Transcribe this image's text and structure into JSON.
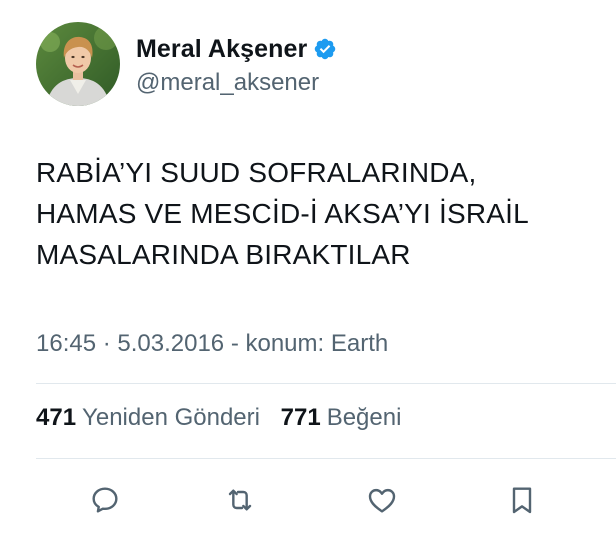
{
  "tweet": {
    "author": {
      "display_name": "Meral Akşener",
      "handle": "@meral_aksener",
      "verified_icon": "verified-badge-icon",
      "verified_color": "#1d9bf0"
    },
    "text_lines": [
      "RABİA’YI SUUD SOFRALARINDA,",
      "HAMAS VE MESCİD-İ AKSA’YI İSRAİL",
      "MASALARINDA BIRAKTILAR"
    ],
    "meta": "16:45 · 5.03.2016 - konum: Earth",
    "stats": {
      "reposts_count": "471",
      "reposts_label": "Yeniden Gönderi",
      "likes_count": "771",
      "likes_label": "Beğeni"
    },
    "actions": {
      "reply_icon": "reply-icon",
      "repost_icon": "repost-icon",
      "like_icon": "like-icon",
      "bookmark_icon": "bookmark-icon"
    }
  },
  "colors": {
    "text_primary": "#0f1419",
    "text_secondary": "#536471",
    "divider": "#e1e8ed",
    "accent": "#1d9bf0"
  }
}
